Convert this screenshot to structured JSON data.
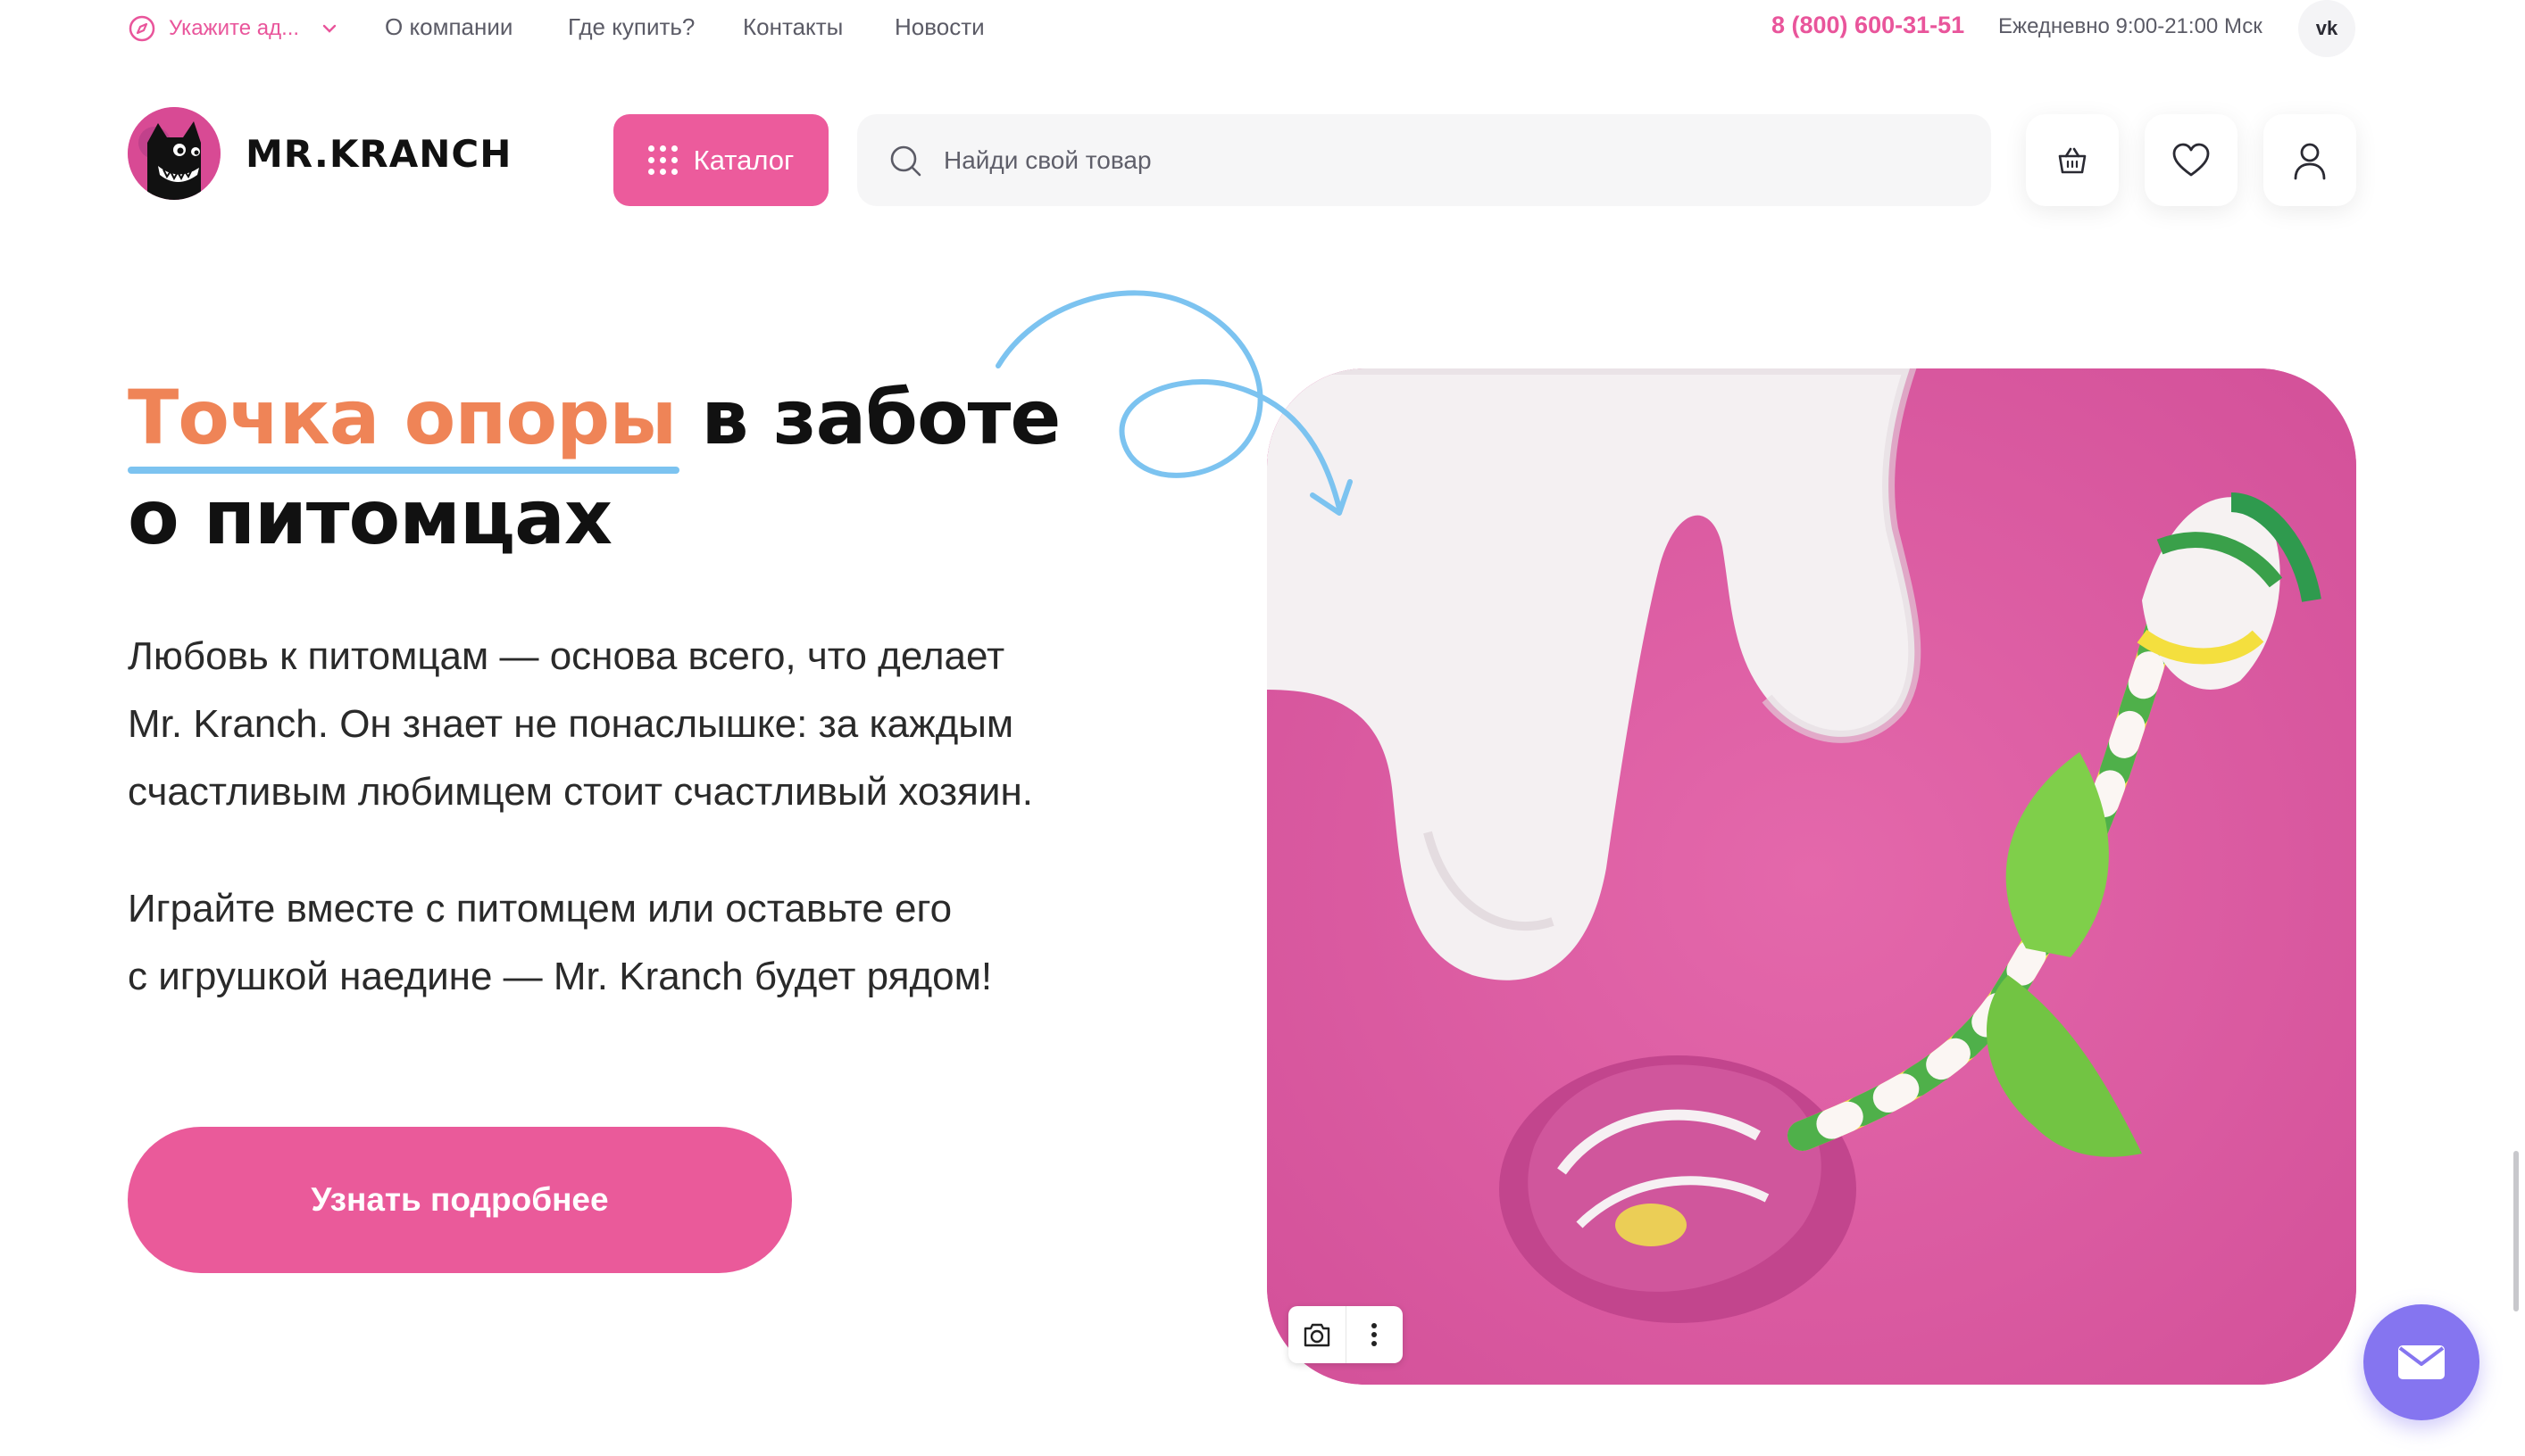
{
  "topbar": {
    "location_label": "Укажите ад...",
    "links": [
      "О компании",
      "Где купить?",
      "Контакты",
      "Новости"
    ],
    "phone": "8 (800) 600-31-51",
    "hours": "Ежедневно 9:00-21:00 Мск",
    "social": "vk"
  },
  "header": {
    "brand": "MR.KRANCH",
    "catalog_label": "Каталог",
    "search_placeholder": "Найди свой товар",
    "icons": [
      "basket-icon",
      "heart-icon",
      "user-icon"
    ]
  },
  "hero": {
    "title_accent": "Точка опоры",
    "title_rest_line1": " в заботе",
    "title_line2": "о питомцах",
    "paragraph1": [
      "Любовь к питомцам — основа всего, что делает",
      "Mr. Kranch. Он знает не понаслышке: за каждым",
      "счастливым любимцем стоит счастливый хозяин."
    ],
    "paragraph2": [
      "Играйте вместе с питомцем или оставьте его",
      "с игрушкой наедине — Mr. Kranch будет рядом!"
    ],
    "cta_label": "Узнать подробнее"
  },
  "colors": {
    "brand_pink": "#ec5b9c",
    "accent_orange": "#ef8457",
    "underline_blue": "#7cc3f0",
    "mail_purple": "#8575f0"
  }
}
